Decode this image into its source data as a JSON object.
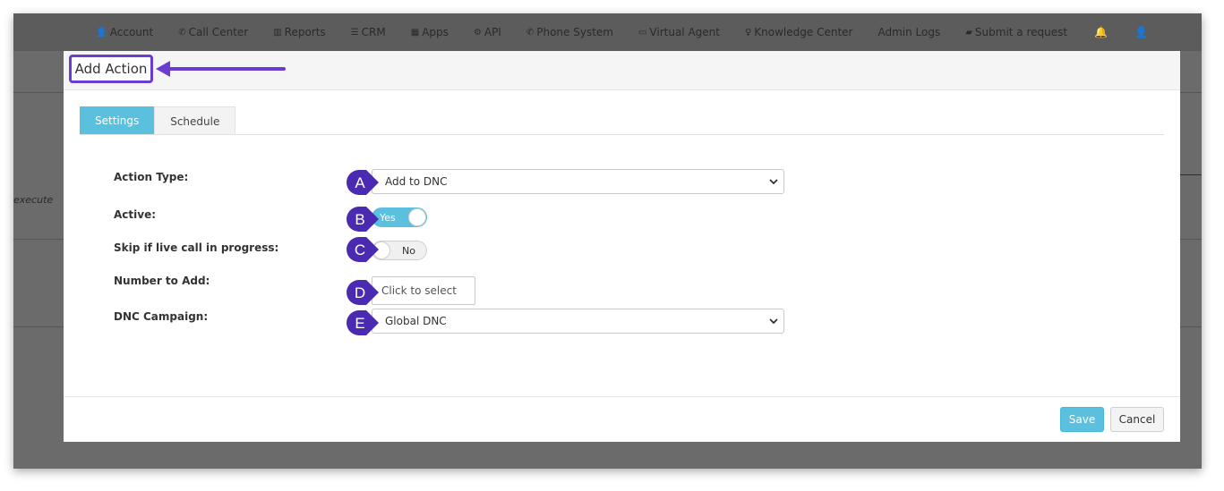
{
  "nav": {
    "items": [
      {
        "icon": "user-icon",
        "label": "Account"
      },
      {
        "icon": "phone-icon",
        "label": "Call Center"
      },
      {
        "icon": "bar-chart-icon",
        "label": "Reports"
      },
      {
        "icon": "list-icon",
        "label": "CRM"
      },
      {
        "icon": "grid-icon",
        "label": "Apps"
      },
      {
        "icon": "gear-icon",
        "label": "API"
      },
      {
        "icon": "phone-icon",
        "label": "Phone System"
      },
      {
        "icon": "monitor-icon",
        "label": "Virtual Agent"
      },
      {
        "icon": "lightbulb-icon",
        "label": "Knowledge Center"
      },
      {
        "icon": "",
        "label": "Admin Logs"
      },
      {
        "icon": "ticket-icon",
        "label": "Submit a request"
      }
    ]
  },
  "background": {
    "snippet": "execute"
  },
  "modal": {
    "title": "Add Action",
    "tabs": [
      {
        "label": "Settings",
        "active": true
      },
      {
        "label": "Schedule",
        "active": false
      }
    ],
    "fields": {
      "action_type": {
        "label": "Action Type:",
        "value": "Add to DNC",
        "badge": "A"
      },
      "active": {
        "label": "Active:",
        "value": "Yes",
        "badge": "B"
      },
      "skip_live": {
        "label": "Skip if live call in progress:",
        "value": "No",
        "badge": "C"
      },
      "number_to_add": {
        "label": "Number to Add:",
        "placeholder": "Click to select",
        "badge": "D"
      },
      "dnc_campaign": {
        "label": "DNC Campaign:",
        "value": "Global DNC",
        "badge": "E"
      }
    },
    "buttons": {
      "save": "Save",
      "cancel": "Cancel"
    }
  },
  "colors": {
    "accent": "#5bc0de",
    "annotation": "#6a3ccf",
    "badge": "#4a2ab0"
  }
}
